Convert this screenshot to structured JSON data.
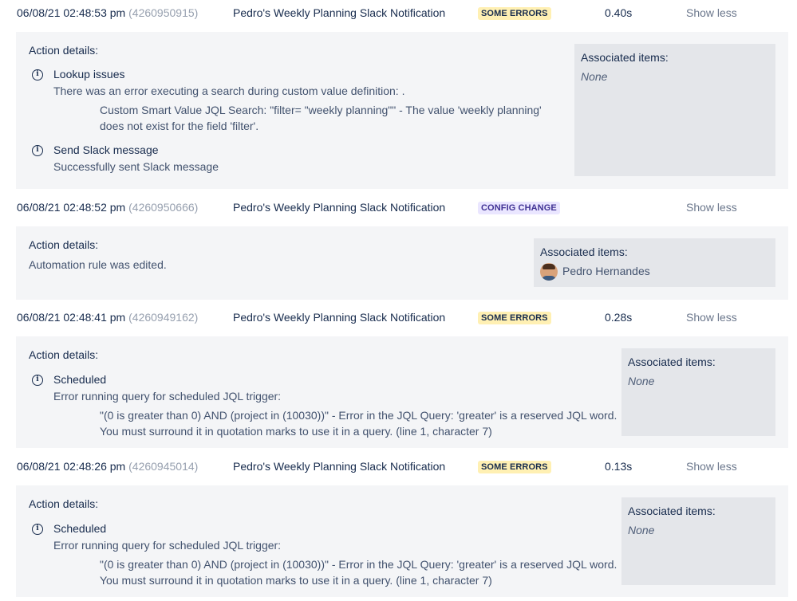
{
  "entries": [
    {
      "date": "06/08/21 02:48:53 pm",
      "id": "(4260950915)",
      "rule": "Pedro's Weekly Planning Slack Notification",
      "status": "SOME ERRORS",
      "duration": "0.40s",
      "toggle": "Show less",
      "details_title": "Action details:",
      "items": [
        {
          "name": "Lookup issues",
          "message": "There was an error executing a search during custom value definition: .",
          "detail": "Custom Smart Value JQL Search: \"filter= \"weekly planning\"\" - The value 'weekly planning' does not exist for the field 'filter'."
        },
        {
          "name": "Send Slack message",
          "message": "Successfully sent Slack message"
        }
      ],
      "assoc_title": "Associated items:",
      "assoc_value": "None"
    },
    {
      "date": "06/08/21 02:48:52 pm",
      "id": "(4260950666)",
      "rule": "Pedro's Weekly Planning Slack Notification",
      "status": "CONFIG CHANGE",
      "toggle": "Show less",
      "details_title": "Action details:",
      "plain": "Automation rule was edited.",
      "assoc_title": "Associated items:",
      "assoc_user": "Pedro Hernandes"
    },
    {
      "date": "06/08/21 02:48:41 pm",
      "id": "(4260949162)",
      "rule": "Pedro's Weekly Planning Slack Notification",
      "status": "SOME ERRORS",
      "duration": "0.28s",
      "toggle": "Show less",
      "details_title": "Action details:",
      "items": [
        {
          "name": "Scheduled",
          "message": "Error running query for scheduled JQL trigger:",
          "detail": "\"(0 is greater than 0) AND (project in (10030))\" - Error in the JQL Query: 'greater' is a reserved JQL word. You must surround it in quotation marks to use it in a query. (line 1, character 7)"
        }
      ],
      "assoc_title": "Associated items:",
      "assoc_value": "None"
    },
    {
      "date": "06/08/21 02:48:26 pm",
      "id": "(4260945014)",
      "rule": "Pedro's Weekly Planning Slack Notification",
      "status": "SOME ERRORS",
      "duration": "0.13s",
      "toggle": "Show less",
      "details_title": "Action details:",
      "items": [
        {
          "name": "Scheduled",
          "message": "Error running query for scheduled JQL trigger:",
          "detail": "\"(0 is greater than 0) AND (project in (10030))\" - Error in the JQL Query: 'greater' is a reserved JQL word. You must surround it in quotation marks to use it in a query. (line 1, character 7)"
        }
      ],
      "assoc_title": "Associated items:",
      "assoc_value": "None"
    }
  ],
  "colors": {
    "text": "#172b4d",
    "muted": "#6b778c",
    "id_gray": "#97a0af",
    "panel_bg": "#f4f5f7",
    "assoc_bg": "#e4e6ea",
    "errors_badge": "#fff0b3",
    "config_badge": "#eae6ff",
    "config_text": "#403294"
  },
  "icons": {
    "info": "info-circle-icon",
    "avatar": "user-avatar"
  }
}
